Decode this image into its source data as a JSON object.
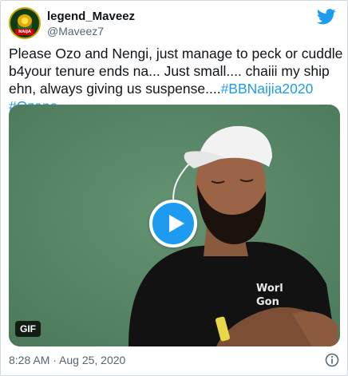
{
  "author": {
    "display_name": "legend_Maveez",
    "handle": "@Maveez7",
    "avatar_badge_text": "NAIJA"
  },
  "tweet": {
    "text_plain": "Please Ozo and Nengi, just manage to peck or cuddle b4your tenure ends na... Just small.... chaiii my ship ehn, always giving us suspense....",
    "hashtags": [
      "#BBNaijia2020",
      "#Ozone"
    ]
  },
  "media": {
    "badge": "GIF",
    "shirt_text_line1": "Worl",
    "shirt_text_line2": "Gon",
    "colors": {
      "background": "#5c8a6a",
      "shirt": "#111111",
      "cap": "#f2f2f2"
    }
  },
  "footer": {
    "timestamp": "8:28 AM · Aug 25, 2020"
  },
  "icons": {
    "brand": "twitter-bird-icon",
    "play": "play-icon",
    "info": "info-icon"
  },
  "colors": {
    "accent": "#1d9bf0",
    "text": "#0f1419",
    "muted": "#536471"
  }
}
